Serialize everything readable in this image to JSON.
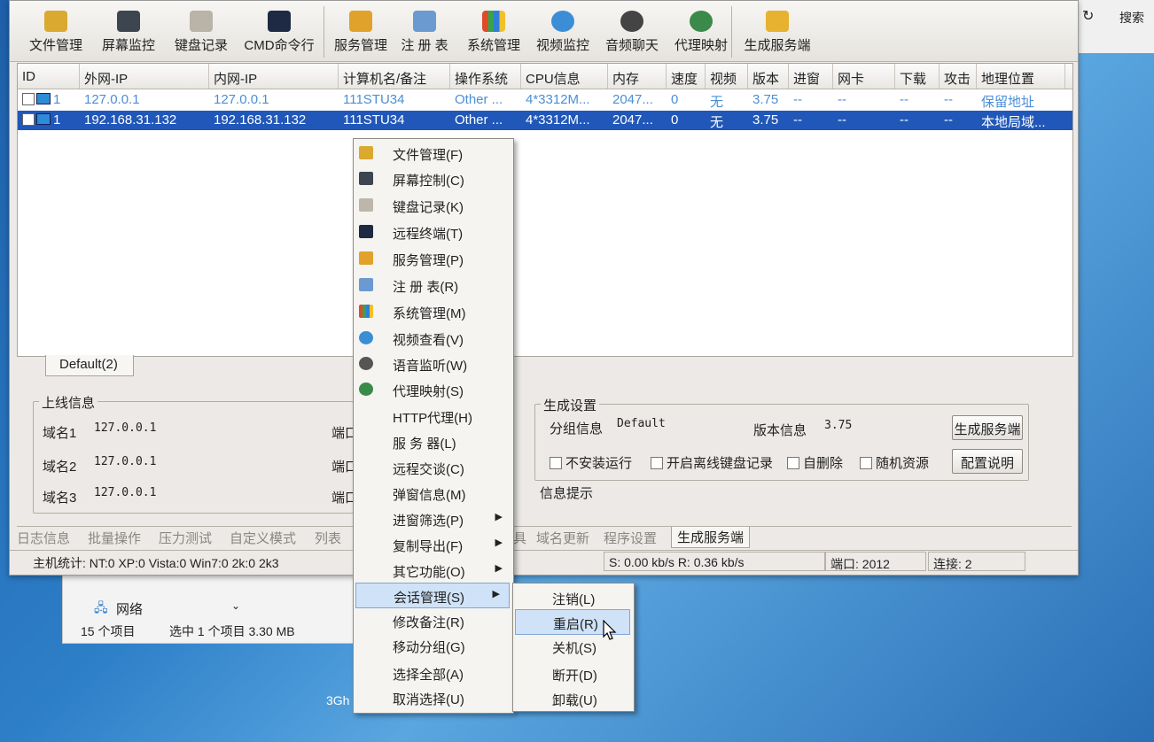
{
  "toolbar": {
    "items": [
      {
        "label": "文件管理",
        "icon": "folder-icon"
      },
      {
        "label": "屏幕监控",
        "icon": "monitor-icon"
      },
      {
        "label": "键盘记录",
        "icon": "keyboard-icon"
      },
      {
        "label": "CMD命令行",
        "icon": "terminal-icon"
      },
      {
        "label": "服务管理",
        "icon": "gears-icon"
      },
      {
        "label": "注 册 表",
        "icon": "registry-icon"
      },
      {
        "label": "系统管理",
        "icon": "windows-icon"
      },
      {
        "label": "视频监控",
        "icon": "webcam-icon"
      },
      {
        "label": "音频聊天",
        "icon": "headset-icon"
      },
      {
        "label": "代理映射",
        "icon": "globe-icon"
      },
      {
        "label": "生成服务端",
        "icon": "package-icon"
      }
    ]
  },
  "grid": {
    "columns": [
      "ID",
      "外网-IP",
      "内网-IP",
      "计算机名/备注",
      "操作系统",
      "CPU信息",
      "内存",
      "速度",
      "视频",
      "版本",
      "进窗",
      "网卡",
      "下载",
      "攻击",
      "地理位置"
    ],
    "rows": [
      {
        "id": "1",
        "wan": "127.0.0.1",
        "lan": "127.0.0.1",
        "name": "111STU34",
        "os": "Other ...",
        "cpu": "4*3312M...",
        "mem": "2047...",
        "speed": "0",
        "video": "无",
        "ver": "3.75",
        "win": "--",
        "nic": "--",
        "dl": "--",
        "atk": "--",
        "geo": "保留地址"
      },
      {
        "id": "1",
        "wan": "192.168.31.132",
        "lan": "192.168.31.132",
        "name": "111STU34",
        "os": "Other ...",
        "cpu": "4*3312M...",
        "mem": "2047...",
        "speed": "0",
        "video": "无",
        "ver": "3.75",
        "win": "--",
        "nic": "--",
        "dl": "--",
        "atk": "--",
        "geo": "本地局域..."
      }
    ]
  },
  "group_tab": "Default(2)",
  "online": {
    "title": "上线信息",
    "domain1_label": "域名1",
    "domain1": "127.0.0.1",
    "domain2_label": "域名2",
    "domain2": "127.0.0.1",
    "domain3_label": "域名3",
    "domain3": "127.0.0.1",
    "port_label": "端口"
  },
  "gen": {
    "title": "生成设置",
    "group_label": "分组信息",
    "group_value": "Default",
    "version_label": "版本信息",
    "version_value": "3.75",
    "gen_button": "生成服务端",
    "config_button": "配置说明",
    "opt1": "不安装运行",
    "opt2": "开启离线键盘记录",
    "opt3": "自删除",
    "opt4": "随机资源",
    "info_label": "信息提示"
  },
  "bottom_tabs": [
    "日志信息",
    "批量操作",
    "压力测试",
    "自定义模式",
    "列表",
    "具",
    "域名更新",
    "程序设置",
    "生成服务端"
  ],
  "status": {
    "host_stats": "主机统计: NT:0  XP:0  Vista:0  Win7:0  2k:0  2k3",
    "speed": "S: 0.00 kb/s R: 0.36 kb/s",
    "port": "端口: 2012",
    "conn": "连接: 2"
  },
  "context_menu": [
    {
      "label": "文件管理(F)",
      "icon": "folder-icon"
    },
    {
      "label": "屏幕控制(C)",
      "icon": "monitor-icon"
    },
    {
      "label": "键盘记录(K)",
      "icon": "keyboard-icon"
    },
    {
      "label": "远程终端(T)",
      "icon": "terminal-icon"
    },
    {
      "label": "服务管理(P)",
      "icon": "gears-icon"
    },
    {
      "label": "注 册 表(R)",
      "icon": "registry-icon"
    },
    {
      "label": "系统管理(M)",
      "icon": "windows-icon"
    },
    {
      "label": "视频查看(V)",
      "icon": "webcam-icon"
    },
    {
      "label": "语音监听(W)",
      "icon": "headset-icon"
    },
    {
      "label": "代理映射(S)",
      "icon": "globe-icon"
    },
    {
      "label": "HTTP代理(H)"
    },
    {
      "label": "服 务 器(L)"
    },
    {
      "label": "远程交谈(C)"
    },
    {
      "label": "弹窗信息(M)"
    },
    {
      "label": "进窗筛选(P)",
      "submenu": true
    },
    {
      "label": "复制导出(F)",
      "submenu": true
    },
    {
      "label": "其它功能(O)",
      "submenu": true
    },
    {
      "label": "会话管理(S)",
      "submenu": true,
      "highlighted": true
    },
    {
      "label": "修改备注(R)"
    },
    {
      "label": "移动分组(G)"
    },
    {
      "label": "选择全部(A)"
    },
    {
      "label": "取消选择(U)"
    }
  ],
  "session_submenu": [
    {
      "label": "注销(L)"
    },
    {
      "label": "重启(R)",
      "highlighted": true
    },
    {
      "label": "关机(S)"
    },
    {
      "label": "断开(D)"
    },
    {
      "label": "卸载(U)"
    }
  ],
  "explorer": {
    "search": "搜索",
    "network": "网络",
    "item_count": "15 个项目",
    "selected": "选中 1 个项目  3.30 MB",
    "desktop_text": "3Gh"
  },
  "colors": {
    "selection": "#2157b8",
    "menu_highlight": "#cfe2f7",
    "row1_text": "#4b8fd6"
  }
}
